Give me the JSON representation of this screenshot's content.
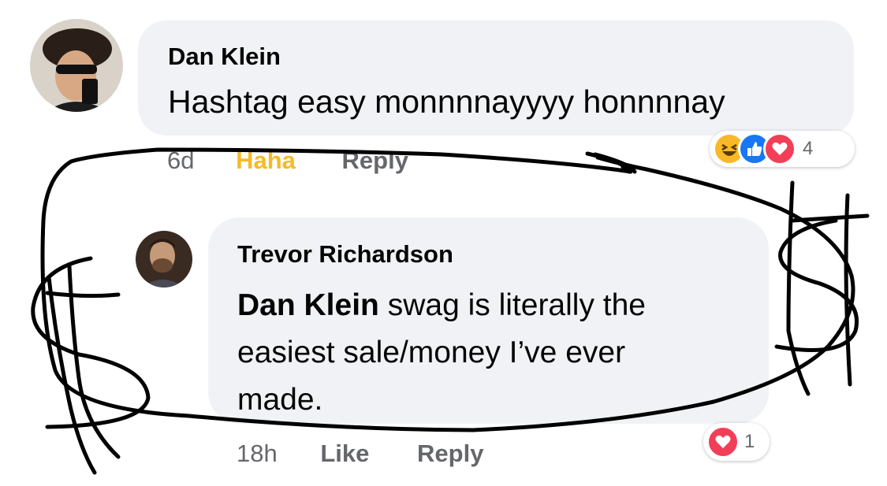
{
  "comments": [
    {
      "author": "Dan Klein",
      "text": "Hashtag easy monnnnayyyy honnnnay",
      "time": "6d",
      "reaction_label": "Haha",
      "reply_label": "Reply",
      "reaction_count": "4",
      "reactions": [
        "haha-icon",
        "like-icon",
        "love-icon"
      ]
    },
    {
      "author": "Trevor Richardson",
      "mention": "Dan Klein",
      "text_line1": " swag is literally the",
      "text_line2": "easiest sale/money I’ve ever",
      "text_line3": "made.",
      "time": "18h",
      "like_label": "Like",
      "reply_label": "Reply",
      "reaction_count": "1",
      "reactions": [
        "love-icon"
      ]
    }
  ],
  "colors": {
    "bubble": "#f0f2f5",
    "haha": "#f7b928",
    "like": "#1877f2",
    "love": "#f33e58",
    "muted": "#65676b",
    "doodle": "#000000"
  }
}
